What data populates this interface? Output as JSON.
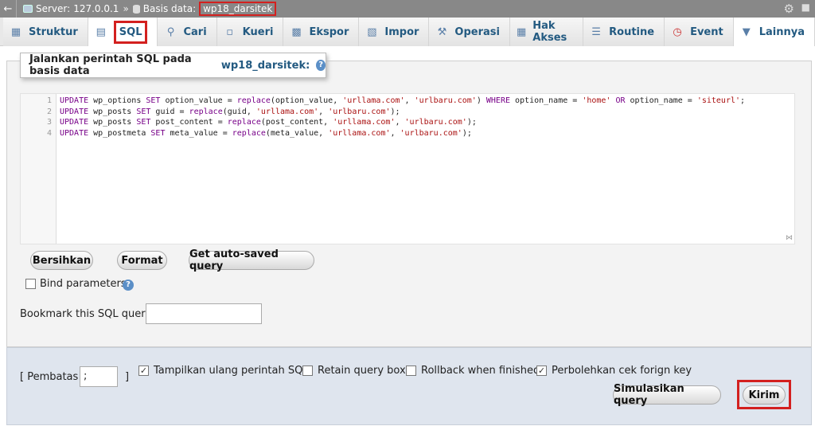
{
  "topbar": {
    "server_label": "Server:",
    "server_value": "127.0.0.1",
    "arrow": "»",
    "db_label": "Basis data:",
    "db_value": "wp18_darsitek"
  },
  "tabs": [
    {
      "label": "Struktur",
      "icon": "structure-icon"
    },
    {
      "label": "SQL",
      "icon": "sql-icon"
    },
    {
      "label": "Cari",
      "icon": "search-icon"
    },
    {
      "label": "Kueri",
      "icon": "query-icon"
    },
    {
      "label": "Ekspor",
      "icon": "export-icon"
    },
    {
      "label": "Impor",
      "icon": "import-icon"
    },
    {
      "label": "Operasi",
      "icon": "wrench-icon"
    },
    {
      "label": "Hak Akses",
      "icon": "privileges-icon"
    },
    {
      "label": "Routine",
      "icon": "routine-icon"
    },
    {
      "label": "Event",
      "icon": "clock-icon"
    },
    {
      "label": "Lainnya",
      "icon": "chevron-down-icon"
    }
  ],
  "panel": {
    "legend_prefix": "Jalankan perintah SQL pada basis data",
    "legend_db": "wp18_darsitek:"
  },
  "editor": {
    "lines": [
      {
        "num": "1",
        "tokens": [
          [
            "kw",
            "UPDATE"
          ],
          [
            "t",
            " wp_options "
          ],
          [
            "kw",
            "SET"
          ],
          [
            "t",
            " option_value = "
          ],
          [
            "fn",
            "replace"
          ],
          [
            "t",
            "(option_value, "
          ],
          [
            "str",
            "'urllama.com'"
          ],
          [
            "t",
            ", "
          ],
          [
            "str",
            "'urlbaru.com'"
          ],
          [
            "t",
            ") "
          ],
          [
            "kw",
            "WHERE"
          ],
          [
            "t",
            " option_name = "
          ],
          [
            "str",
            "'home'"
          ],
          [
            "t",
            " "
          ],
          [
            "kw",
            "OR"
          ],
          [
            "t",
            " option_name = "
          ],
          [
            "str",
            "'siteurl'"
          ],
          [
            "t",
            ";"
          ]
        ]
      },
      {
        "num": "2",
        "tokens": [
          [
            "kw",
            "UPDATE"
          ],
          [
            "t",
            " wp_posts "
          ],
          [
            "kw",
            "SET"
          ],
          [
            "t",
            " guid = "
          ],
          [
            "fn",
            "replace"
          ],
          [
            "t",
            "(guid, "
          ],
          [
            "str",
            "'urllama.com'"
          ],
          [
            "t",
            ", "
          ],
          [
            "str",
            "'urlbaru.com'"
          ],
          [
            "t",
            ");"
          ]
        ]
      },
      {
        "num": "3",
        "tokens": [
          [
            "kw",
            "UPDATE"
          ],
          [
            "t",
            " wp_posts "
          ],
          [
            "kw",
            "SET"
          ],
          [
            "t",
            " post_content = "
          ],
          [
            "fn",
            "replace"
          ],
          [
            "t",
            "(post_content, "
          ],
          [
            "str",
            "'urllama.com'"
          ],
          [
            "t",
            ", "
          ],
          [
            "str",
            "'urlbaru.com'"
          ],
          [
            "t",
            ");"
          ]
        ]
      },
      {
        "num": "4",
        "tokens": [
          [
            "kw",
            "UPDATE"
          ],
          [
            "t",
            " wp_postmeta "
          ],
          [
            "kw",
            "SET"
          ],
          [
            "t",
            " meta_value = "
          ],
          [
            "fn",
            "replace"
          ],
          [
            "t",
            "(meta_value, "
          ],
          [
            "str",
            "'urllama.com'"
          ],
          [
            "t",
            ", "
          ],
          [
            "str",
            "'urlbaru.com'"
          ],
          [
            "t",
            ");"
          ]
        ]
      }
    ]
  },
  "buttons": {
    "clear": "Bersihkan",
    "format": "Format",
    "autosaved": "Get auto-saved query",
    "simulate": "Simulasikan query",
    "submit": "Kirim"
  },
  "bind_parameters": {
    "label": "Bind parameters",
    "checked": false
  },
  "bookmark": {
    "label": "Bookmark this SQL query:",
    "value": ""
  },
  "bottom": {
    "delimiter_label_open": "[ Pembatas",
    "delimiter_value": ";",
    "delimiter_label_close": "]",
    "options": [
      {
        "label": "Tampilkan ulang perintah SQL",
        "checked": true
      },
      {
        "label": "Retain query box",
        "checked": false
      },
      {
        "label": "Rollback when finished",
        "checked": false
      },
      {
        "label": "Perbolehkan cek forign key",
        "checked": true
      }
    ]
  },
  "colors": {
    "accent": "#235a81",
    "highlight": "#d3201f"
  }
}
